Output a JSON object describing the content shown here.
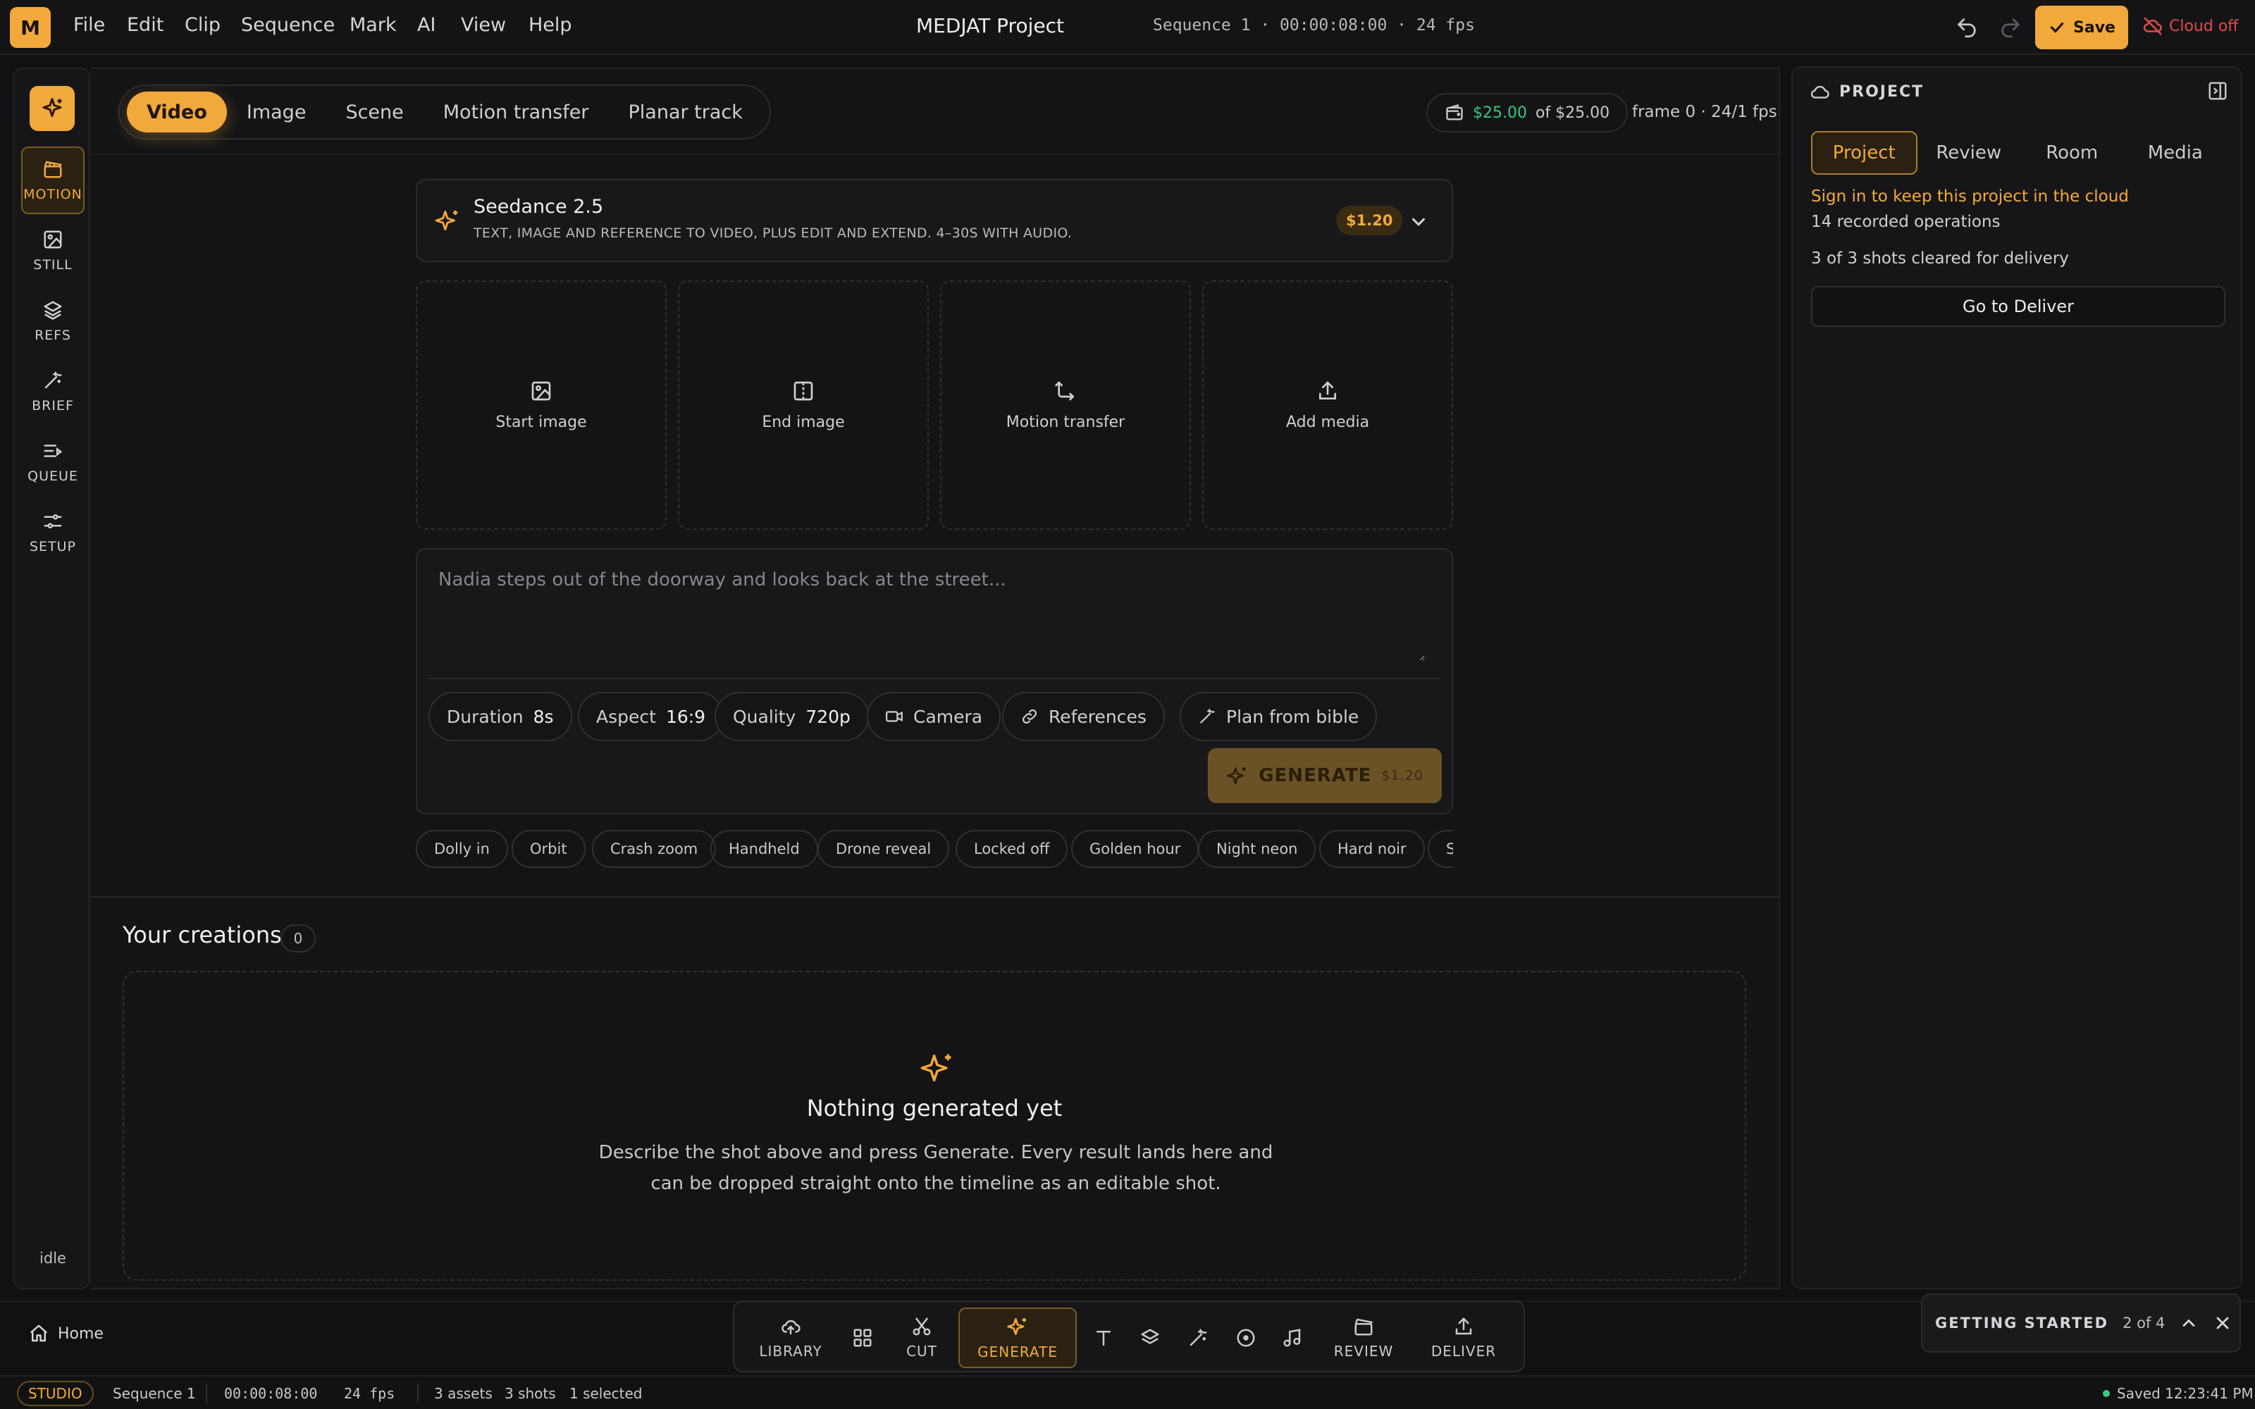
{
  "menubar": {
    "logo": "M",
    "menus": [
      "File",
      "Edit",
      "Clip",
      "Sequence",
      "Mark",
      "AI",
      "View",
      "Help"
    ],
    "title": "MEDJAT Project",
    "sequence_info": "Sequence 1 · 00:00:08:00 · 24 fps",
    "save_label": "Save",
    "cloud_status": "Cloud off"
  },
  "left_rail": {
    "items": [
      {
        "label": "MOTION",
        "icon": "clapper-icon"
      },
      {
        "label": "STILL",
        "icon": "image-icon"
      },
      {
        "label": "REFS",
        "icon": "layers-icon"
      },
      {
        "label": "BRIEF",
        "icon": "wand-icon"
      },
      {
        "label": "QUEUE",
        "icon": "list-icon"
      },
      {
        "label": "SETUP",
        "icon": "sliders-icon"
      }
    ],
    "status": "idle"
  },
  "mode_tabs": [
    "Video",
    "Image",
    "Scene",
    "Motion transfer",
    "Planar track"
  ],
  "budget": {
    "amount": "$25.00",
    "of": "of $25.00"
  },
  "frame_info": "frame 0 · 24/1 fps",
  "model": {
    "name": "Seedance 2.5",
    "description": "TEXT, IMAGE AND REFERENCE TO VIDEO, PLUS EDIT AND EXTEND. 4–30S WITH AUDIO.",
    "price": "$1.20"
  },
  "slots": [
    {
      "label": "Start image",
      "icon": "image-icon"
    },
    {
      "label": "End image",
      "icon": "split-icon"
    },
    {
      "label": "Motion transfer",
      "icon": "motion-icon"
    },
    {
      "label": "Add media",
      "icon": "upload-icon"
    }
  ],
  "prompt": {
    "placeholder": "Nadia steps out of the doorway and looks back at the street..."
  },
  "params": {
    "duration_label": "Duration",
    "duration_value": "8s",
    "aspect_label": "Aspect",
    "aspect_value": "16:9",
    "quality_label": "Quality",
    "quality_value": "720p",
    "camera_label": "Camera",
    "references_label": "References",
    "plan_label": "Plan from bible"
  },
  "generate": {
    "label": "GENERATE",
    "price": "$1.20"
  },
  "presets": [
    "Dolly in",
    "Orbit",
    "Crash zoom",
    "Handheld",
    "Drone reveal",
    "Locked off",
    "Golden hour",
    "Night neon",
    "Hard noir",
    "Se"
  ],
  "creations": {
    "title": "Your creations",
    "count": "0",
    "empty_title": "Nothing generated yet",
    "empty_desc": "Describe the shot above and press Generate. Every result lands here and can be dropped straight onto the timeline as an editable shot."
  },
  "right_panel": {
    "title": "PROJECT",
    "tabs": [
      "Project",
      "Review",
      "Room",
      "Media"
    ],
    "signin": "Sign in to keep this project in the cloud",
    "ops": "14 recorded operations",
    "shots": "3 of 3 shots cleared for delivery",
    "deliver_btn": "Go to Deliver"
  },
  "dock": {
    "home": "Home",
    "library": "LIBRARY",
    "cut": "CUT",
    "generate": "GENERATE",
    "review": "REVIEW",
    "deliver": "DELIVER"
  },
  "getting_started": {
    "title": "GETTING STARTED",
    "step": "2 of 4"
  },
  "statusbar": {
    "mode": "STUDIO",
    "sequence": "Sequence 1",
    "timecode": "00:00:08:00",
    "fps": "24 fps",
    "assets": "3 assets",
    "shots": "3 shots",
    "selected": "1 selected",
    "saved": "Saved 12:23:41 PM"
  },
  "colors": {
    "accent": "#f2a93b",
    "success": "#3bc77b",
    "danger": "#e04a4a",
    "bg": "#111113"
  }
}
